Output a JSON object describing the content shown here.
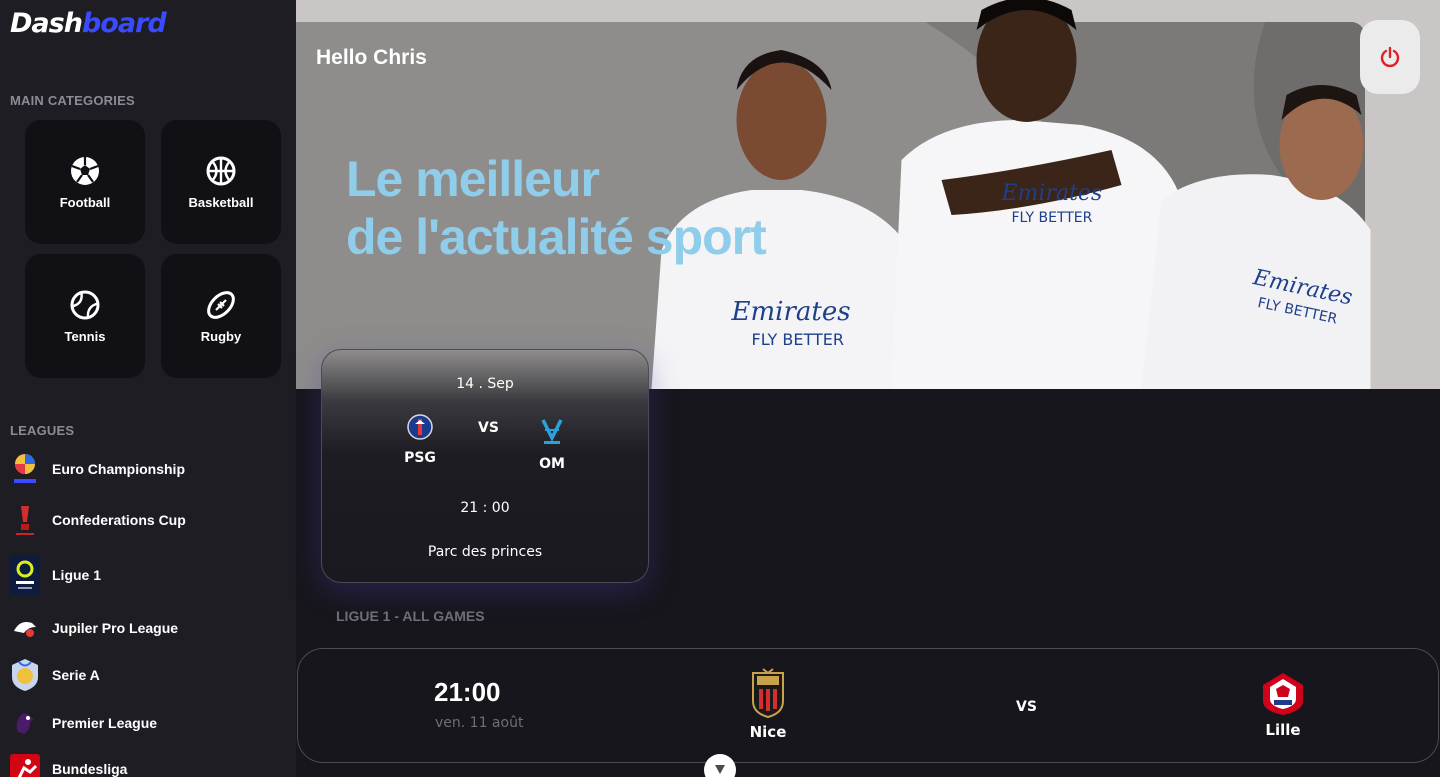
{
  "app": {
    "logo_part1": "Dash",
    "logo_part2": "board"
  },
  "sidebar": {
    "categories_title": "MAIN CATEGORIES",
    "categories": [
      {
        "label": "Football",
        "icon": "football-icon"
      },
      {
        "label": "Basketball",
        "icon": "basketball-icon"
      },
      {
        "label": "Tennis",
        "icon": "tennis-icon"
      },
      {
        "label": "Rugby",
        "icon": "rugby-icon"
      }
    ],
    "leagues_title": "LEAGUES",
    "leagues": [
      {
        "label": "Euro Championship",
        "icon": "euro-championship-logo"
      },
      {
        "label": "Confederations Cup",
        "icon": "confederations-cup-logo"
      },
      {
        "label": "Ligue 1",
        "icon": "ligue-1-logo"
      },
      {
        "label": "Jupiler Pro League",
        "icon": "jupiler-pro-league-logo"
      },
      {
        "label": "Serie A",
        "icon": "serie-a-logo"
      },
      {
        "label": "Premier League",
        "icon": "premier-league-logo"
      },
      {
        "label": "Bundesliga",
        "icon": "bundesliga-logo"
      }
    ]
  },
  "hero": {
    "greeting": "Hello Chris",
    "headline_line1": "Le meilleur",
    "headline_line2": "de l'actualité sport"
  },
  "featured_match": {
    "date": "14 . Sep",
    "home": "PSG",
    "vs": "VS",
    "away": "OM",
    "time": "21 : 00",
    "venue": "Parc des princes"
  },
  "games": {
    "title": "LIGUE 1 - ALL GAMES",
    "items": [
      {
        "time": "21:00",
        "date": "ven. 11 août",
        "home": "Nice",
        "vs": "VS",
        "away": "Lille"
      }
    ]
  },
  "colors": {
    "accent": "#3a4bff",
    "headline": "#8fcdea",
    "power": "#e0202a"
  }
}
